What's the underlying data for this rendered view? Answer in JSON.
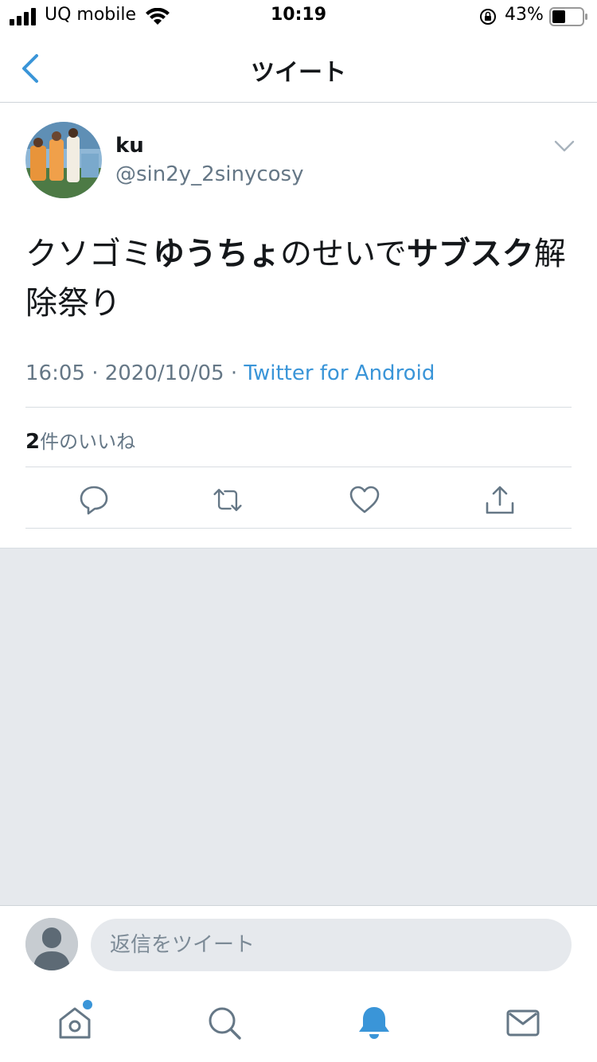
{
  "status": {
    "carrier": "UQ mobile",
    "time": "10:19",
    "battery": "43%"
  },
  "nav": {
    "title": "ツイート"
  },
  "tweet": {
    "name": "ku",
    "handle": "@sin2y_2sinycosy",
    "text_segments": [
      {
        "text": "クソゴミ",
        "bold": false
      },
      {
        "text": "ゆうちょ",
        "bold": true
      },
      {
        "text": "のせいで",
        "bold": false
      },
      {
        "text": "サブスク",
        "bold": true
      },
      {
        "text": "解除祭り",
        "bold": false
      }
    ],
    "timestamp": "16:05 · 2020/10/05 · ",
    "source": "Twitter for Android",
    "likes_count": "2",
    "likes_label": "件のいいね"
  },
  "reply": {
    "placeholder": "返信をツイート"
  },
  "colors": {
    "accent": "#3a95d8",
    "text": "#14171a",
    "secondary": "#657786",
    "background_gray": "#e6e9ed"
  },
  "icons": {
    "actions": [
      "comment-icon",
      "retweet-icon",
      "like-icon",
      "share-icon"
    ],
    "tabs": [
      "home-icon",
      "search-icon",
      "notifications-icon",
      "messages-icon"
    ]
  }
}
